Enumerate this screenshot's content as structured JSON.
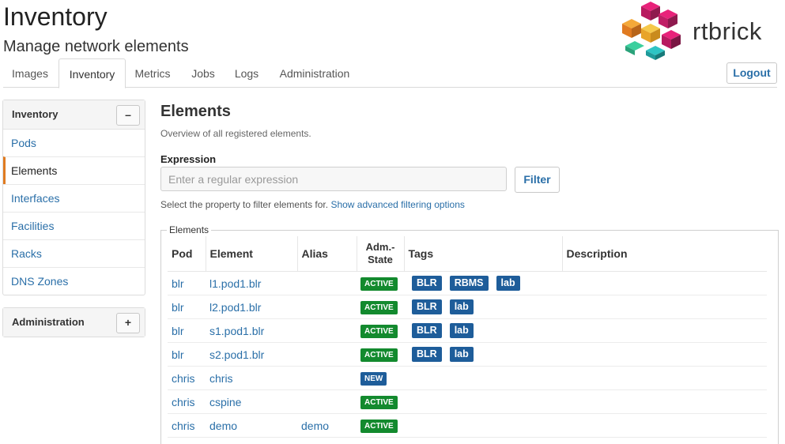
{
  "app": {
    "title": "Inventory",
    "subtitle": "Manage network elements",
    "brand": "rtbrick"
  },
  "header": {
    "logout_label": "Logout"
  },
  "tabs": [
    {
      "label": "Images",
      "active": false
    },
    {
      "label": "Inventory",
      "active": true
    },
    {
      "label": "Metrics",
      "active": false
    },
    {
      "label": "Jobs",
      "active": false
    },
    {
      "label": "Logs",
      "active": false
    },
    {
      "label": "Administration",
      "active": false
    }
  ],
  "sidebar": {
    "inventory_panel": {
      "title": "Inventory",
      "toggle": "–",
      "items": [
        {
          "label": "Pods"
        },
        {
          "label": "Elements"
        },
        {
          "label": "Interfaces"
        },
        {
          "label": "Facilities"
        },
        {
          "label": "Racks"
        },
        {
          "label": "DNS Zones"
        }
      ]
    },
    "admin_panel": {
      "title": "Administration",
      "toggle": "+"
    }
  },
  "main": {
    "title": "Elements",
    "subtitle": "Overview of all registered elements.",
    "expression_label": "Expression",
    "expression_placeholder": "Enter a regular expression",
    "expression_value": "",
    "filter_label": "Filter",
    "help_text": "Select the property to filter elements for.",
    "help_link": "Show advanced filtering options",
    "legend": "Elements"
  },
  "table": {
    "columns": {
      "pod": "Pod",
      "element": "Element",
      "alias": "Alias",
      "adm_state_line1": "Adm.-",
      "adm_state_line2": "State",
      "tags": "Tags",
      "description": "Description"
    },
    "rows": [
      {
        "pod": "blr",
        "element": "l1.pod1.blr",
        "alias": "",
        "state": "ACTIVE",
        "tags": [
          "BLR",
          "RBMS",
          "lab"
        ],
        "description": ""
      },
      {
        "pod": "blr",
        "element": "l2.pod1.blr",
        "alias": "",
        "state": "ACTIVE",
        "tags": [
          "BLR",
          "lab"
        ],
        "description": ""
      },
      {
        "pod": "blr",
        "element": "s1.pod1.blr",
        "alias": "",
        "state": "ACTIVE",
        "tags": [
          "BLR",
          "lab"
        ],
        "description": ""
      },
      {
        "pod": "blr",
        "element": "s2.pod1.blr",
        "alias": "",
        "state": "ACTIVE",
        "tags": [
          "BLR",
          "lab"
        ],
        "description": ""
      },
      {
        "pod": "chris",
        "element": "chris",
        "alias": "",
        "state": "NEW",
        "tags": [],
        "description": ""
      },
      {
        "pod": "chris",
        "element": "cspine",
        "alias": "",
        "state": "ACTIVE",
        "tags": [],
        "description": ""
      },
      {
        "pod": "chris",
        "element": "demo",
        "alias": "demo",
        "state": "ACTIVE",
        "tags": [],
        "description": ""
      }
    ]
  },
  "colors": {
    "active_state": "#138a2e",
    "new_state": "#1e5d9a",
    "tag": "#1e5d9a",
    "link": "#2a6fa8",
    "active_marker": "#e07b21"
  }
}
